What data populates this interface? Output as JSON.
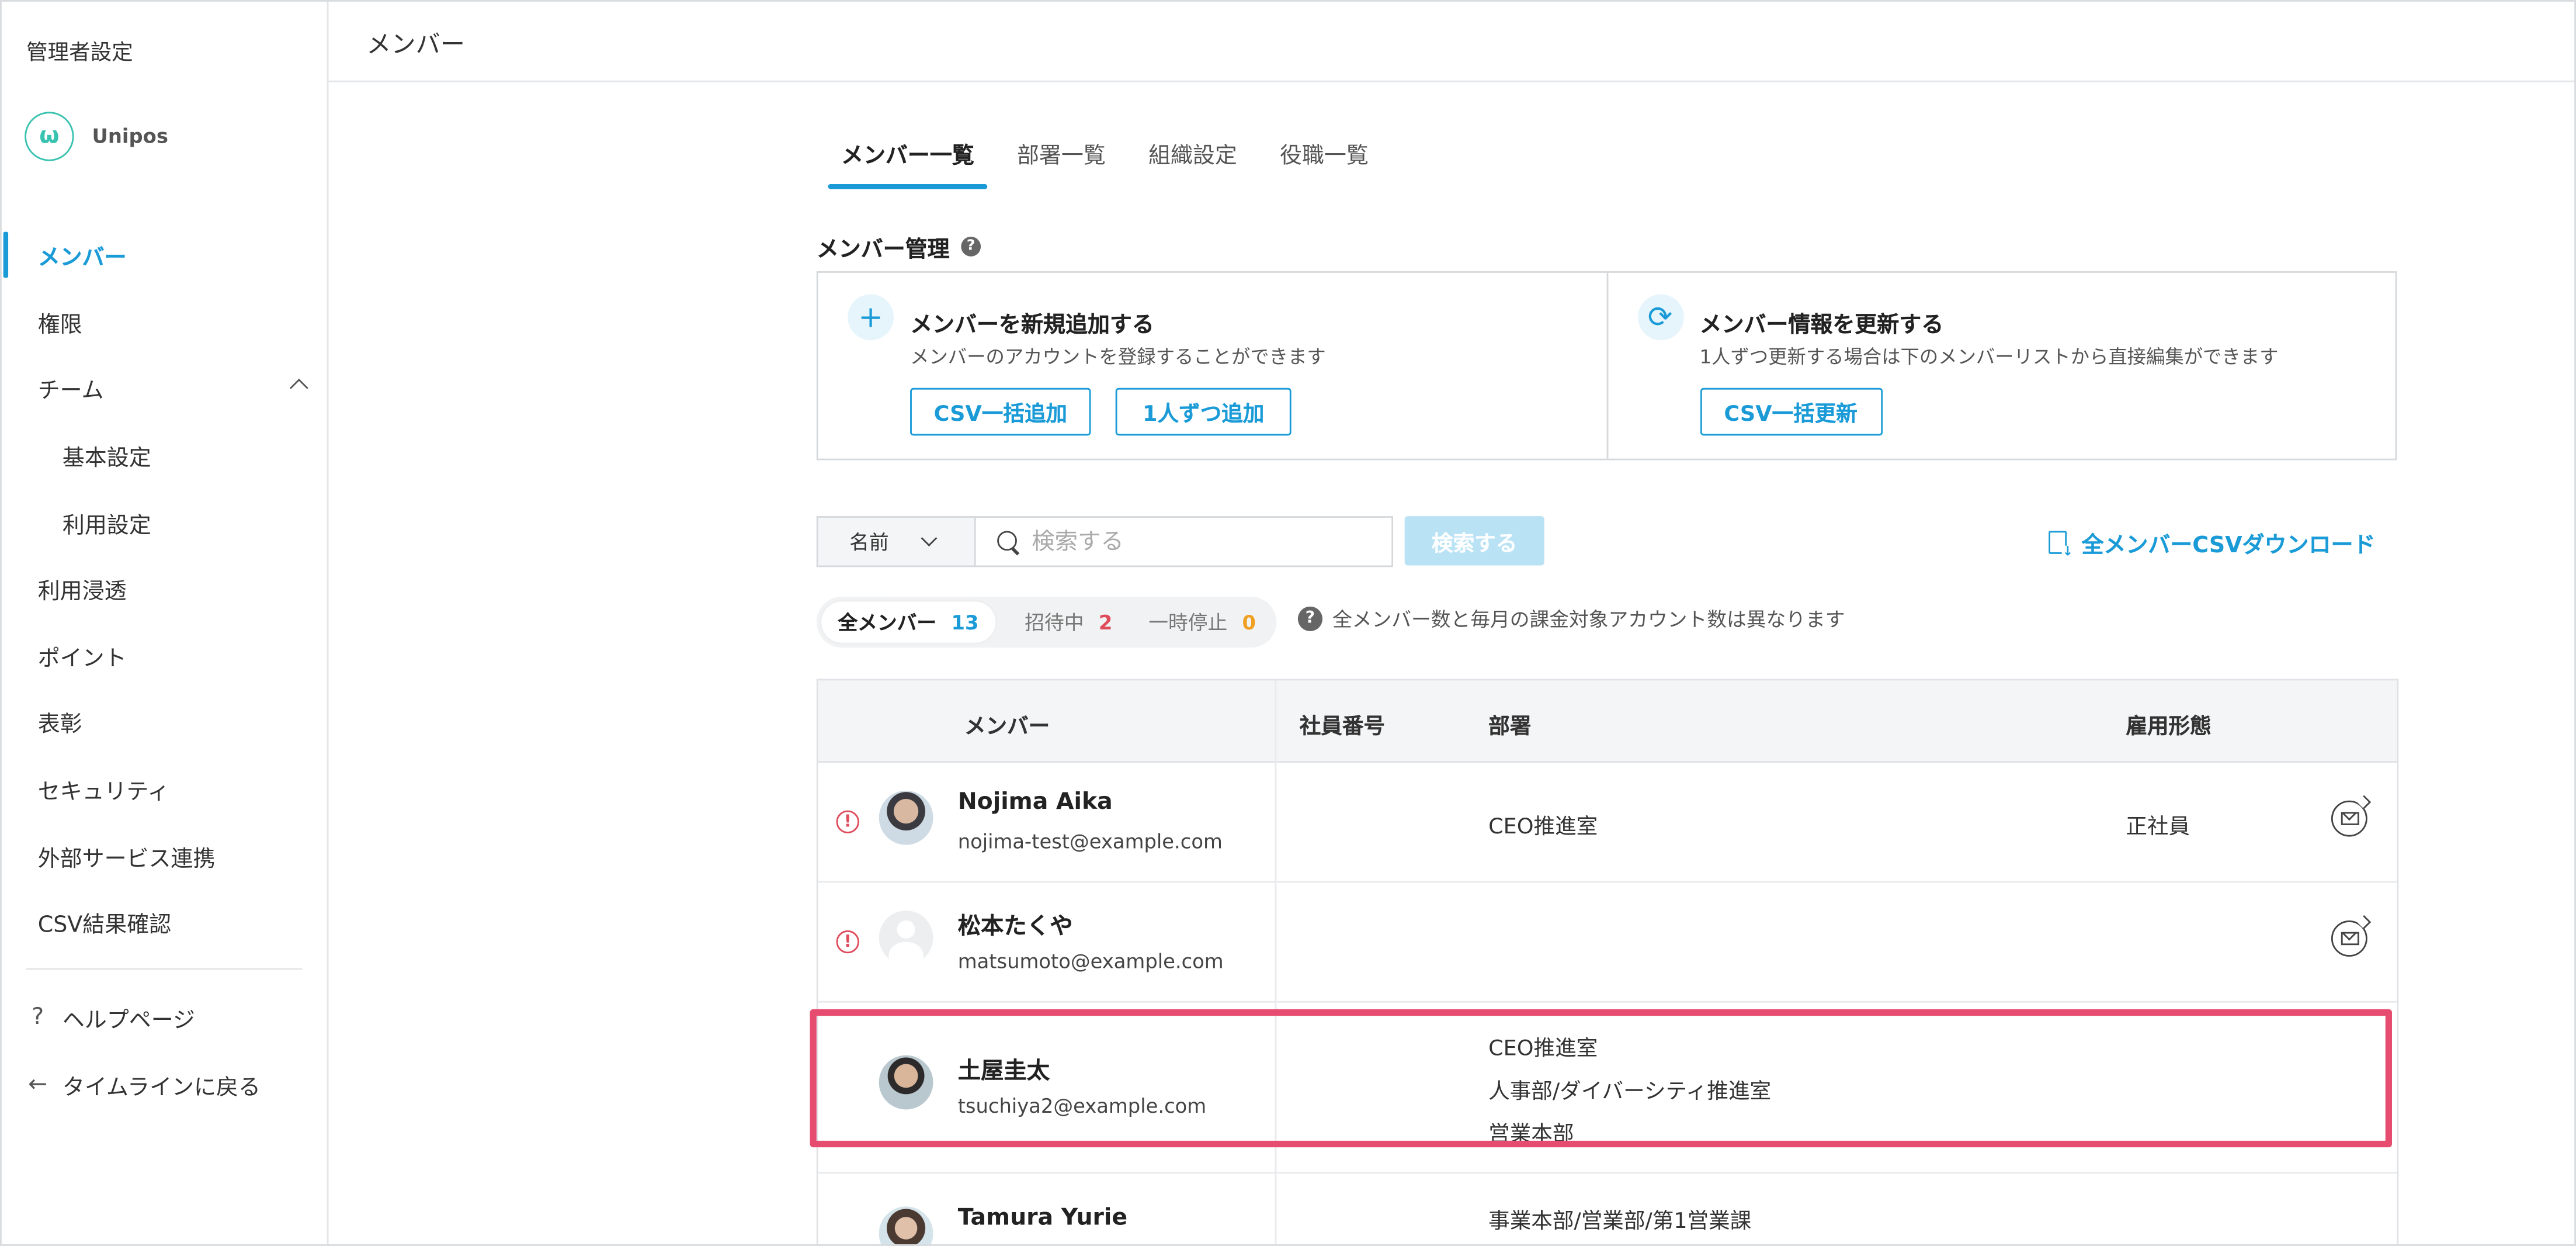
{
  "sidebar": {
    "title": "管理者設定",
    "brand": "Unipos",
    "items": [
      {
        "label": "メンバー",
        "active": true
      },
      {
        "label": "権限"
      },
      {
        "label": "チーム",
        "expanded": true
      },
      {
        "label": "基本設定",
        "sub": true
      },
      {
        "label": "利用設定",
        "sub": true
      },
      {
        "label": "利用浸透"
      },
      {
        "label": "ポイント"
      },
      {
        "label": "表彰"
      },
      {
        "label": "セキュリティ"
      },
      {
        "label": "外部サービス連携"
      },
      {
        "label": "CSV結果確認"
      }
    ],
    "help": {
      "icon": "?",
      "label": "ヘルプページ"
    },
    "back": {
      "icon": "←",
      "label": "タイムラインに戻る"
    }
  },
  "header": {
    "title": "メンバー"
  },
  "tabs": [
    {
      "label": "メンバー一覧",
      "active": true
    },
    {
      "label": "部署一覧"
    },
    {
      "label": "組織設定"
    },
    {
      "label": "役職一覧"
    }
  ],
  "management": {
    "title": "メンバー管理",
    "help_icon": "?",
    "add": {
      "icon": "+",
      "title": "メンバーを新規追加する",
      "desc": "メンバーのアカウントを登録することができます",
      "csv_button": "CSV一括追加",
      "single_button": "1人ずつ追加"
    },
    "update": {
      "icon": "⟳",
      "title": "メンバー情報を更新する",
      "desc": "1人ずつ更新する場合は下のメンバーリストから直接編集ができます",
      "csv_button": "CSV一括更新"
    }
  },
  "search": {
    "field_select": "名前",
    "placeholder": "検索する",
    "button": "検索する",
    "download": "全メンバーCSVダウンロード"
  },
  "filters": {
    "all": {
      "label": "全メンバー",
      "count": "13",
      "color": "#1a9bd7"
    },
    "invited": {
      "label": "招待中",
      "count": "2",
      "color": "#e04b5c"
    },
    "suspended": {
      "label": "一時停止",
      "count": "0",
      "color": "#f0a020"
    },
    "note": "全メンバー数と毎月の課金対象アカウント数は異なります",
    "note_icon": "?"
  },
  "table": {
    "headers": {
      "member": "メンバー",
      "emp_no": "社員番号",
      "dept": "部署",
      "employment": "雇用形態"
    },
    "rows": [
      {
        "name": "Nojima Aika",
        "email": "nojima-test@example.com",
        "emp_no": "",
        "depts": [
          "CEO推進室"
        ],
        "employment": "正社員",
        "warning": "!"
      },
      {
        "name": "松本たくや",
        "email": "matsumoto@example.com",
        "emp_no": "",
        "depts": [],
        "employment": "",
        "warning": "!"
      },
      {
        "name": "土屋圭太",
        "email": "tsuchiya2@example.com",
        "emp_no": "",
        "depts": [
          "CEO推進室",
          "人事部/ダイバーシティ推進室",
          "営業本部"
        ],
        "employment": ""
      },
      {
        "name": "Tamura Yurie",
        "email": "",
        "emp_no": "",
        "depts": [
          "事業本部/営業部/第1営業課"
        ],
        "employment": ""
      }
    ]
  },
  "accent_color": "#1a9bd7",
  "highlight_color": "#e54c6f"
}
